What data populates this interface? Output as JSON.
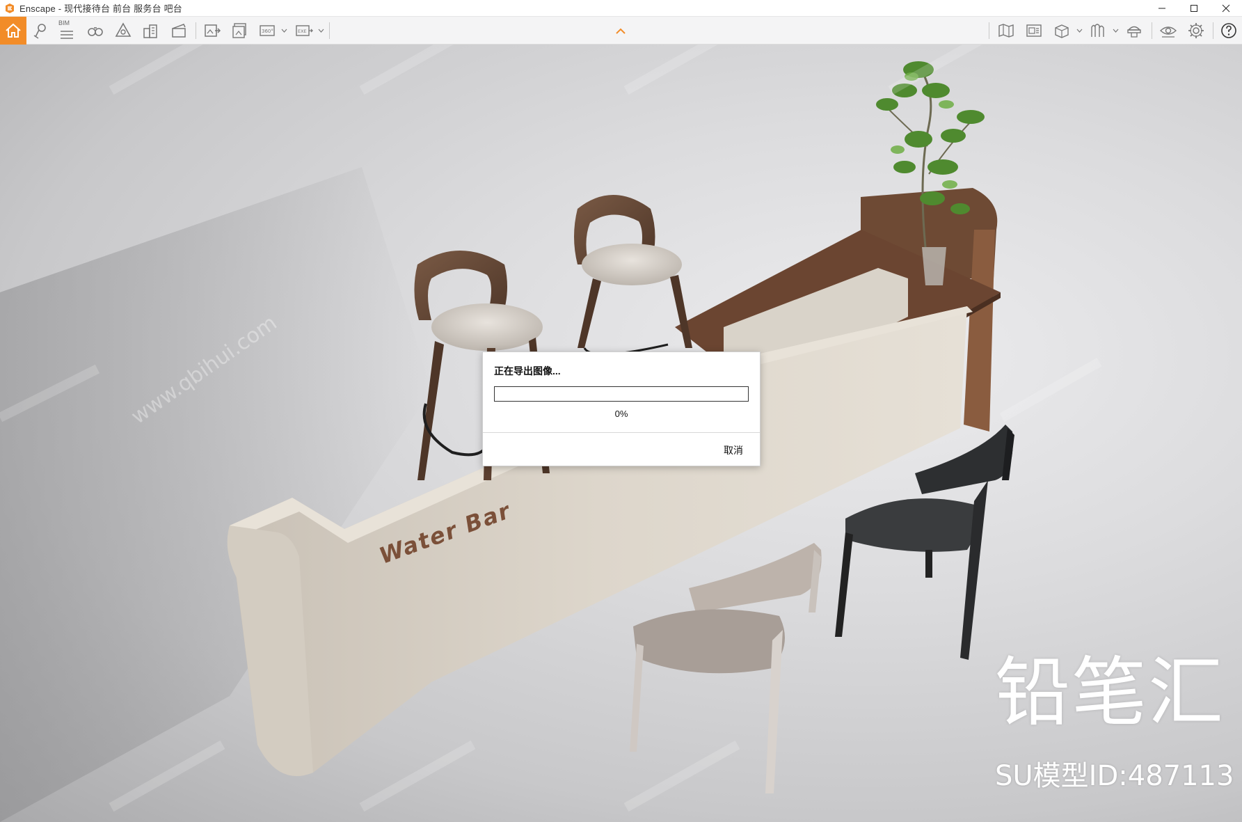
{
  "window": {
    "title": "Enscape - 现代接待台 前台 服务台 吧台"
  },
  "toolbar": {
    "bim_label": "BIM",
    "icons": {
      "home": "home-icon",
      "location": "location-pin-icon",
      "bim": "bim-icon",
      "binoculars": "binoculars-icon",
      "light": "light-icon",
      "buildings": "buildings-icon",
      "clapper": "clapper-icon",
      "export_image": "export-image-icon",
      "batch_export": "batch-export-icon",
      "panorama_360": "panorama-360-icon",
      "export_exe": "export-exe-icon",
      "map": "map-icon",
      "asset_library": "asset-library-icon",
      "cube_view": "cube-view-icon",
      "material": "material-icon",
      "hat": "visual-settings-icon",
      "eye": "eye-icon",
      "settings": "gear-icon",
      "help": "help-icon"
    },
    "accent_color": "#f28c28"
  },
  "scene": {
    "bar_sign": "Water Bar"
  },
  "watermark": {
    "brand": "铅笔汇",
    "model_id": "SU模型ID:487113",
    "url_text": "www.qbihui.com"
  },
  "dialog": {
    "title": "正在导出图像...",
    "progress_fraction": 0,
    "percent_text": "0%",
    "cancel_label": "取消"
  }
}
